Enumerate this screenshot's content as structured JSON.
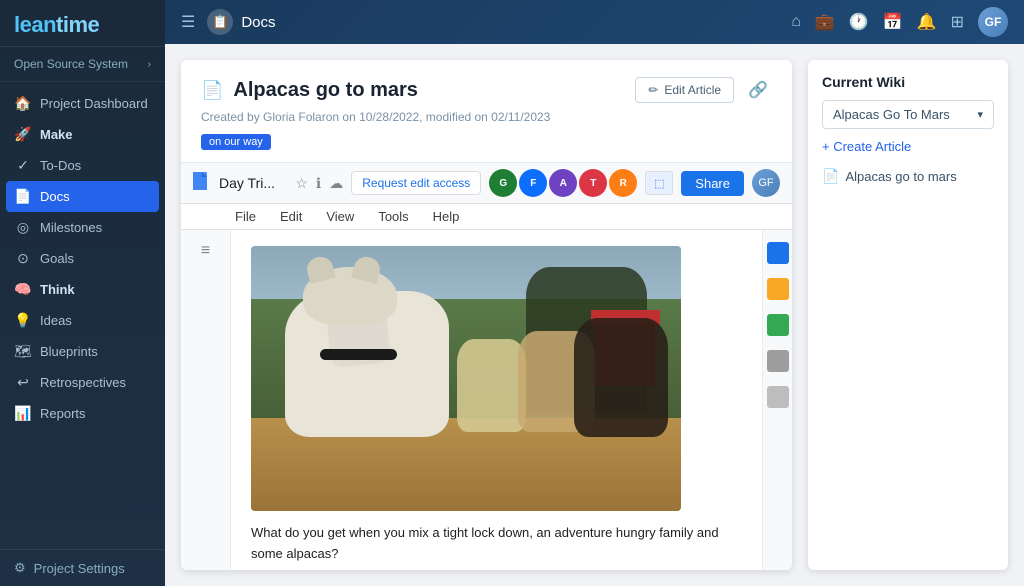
{
  "app": {
    "logo": "leantime",
    "workspace": "Open Source System"
  },
  "topbar": {
    "page_title": "Docs",
    "nav_icons": [
      "home",
      "briefcase",
      "clock",
      "calendar",
      "bell",
      "grid"
    ],
    "avatar_initials": "GF"
  },
  "sidebar": {
    "items": [
      {
        "id": "project-dashboard",
        "label": "Project Dashboard",
        "icon": "🏠",
        "active": false
      },
      {
        "id": "make",
        "label": "Make",
        "icon": "🚀",
        "active": false,
        "section": true
      },
      {
        "id": "to-dos",
        "label": "To-Dos",
        "icon": "✓",
        "active": false
      },
      {
        "id": "docs",
        "label": "Docs",
        "icon": "📄",
        "active": true
      },
      {
        "id": "milestones",
        "label": "Milestones",
        "icon": "◎",
        "active": false
      },
      {
        "id": "goals",
        "label": "Goals",
        "icon": "⊙",
        "active": false
      },
      {
        "id": "think",
        "label": "Think",
        "icon": "🧠",
        "active": false,
        "section": true
      },
      {
        "id": "ideas",
        "label": "Ideas",
        "icon": "💡",
        "active": false
      },
      {
        "id": "blueprints",
        "label": "Blueprints",
        "icon": "🗺",
        "active": false
      },
      {
        "id": "retrospectives",
        "label": "Retrospectives",
        "icon": "↩",
        "active": false
      },
      {
        "id": "reports",
        "label": "Reports",
        "icon": "📊",
        "active": false
      }
    ],
    "settings_label": "Project Settings"
  },
  "doc": {
    "title": "Alpacas go to mars",
    "icon": "📄",
    "meta": "Created by Gloria Folaron on 10/28/2022, modified on 02/11/2023",
    "tag": "on our way",
    "edit_btn": "Edit Article",
    "gdocs": {
      "doc_name": "Day Tri...",
      "menu": [
        "File",
        "Edit",
        "View",
        "Tools",
        "Help"
      ],
      "req_edit": "Request edit access",
      "share": "Share",
      "avatars": [
        "G",
        "F",
        "A",
        "T",
        "R"
      ],
      "avatar_colors": [
        "#1e7e34",
        "#0d6efd",
        "#6f42c1",
        "#dc3545",
        "#fd7e14"
      ],
      "body_text": "What do you get when you mix a tight lock down, an adventure hungry family and some alpacas?"
    }
  },
  "wiki": {
    "title": "Current Wiki",
    "selected": "Alpacas Go To Mars",
    "create_link": "+ Create Article",
    "articles": [
      {
        "label": "Alpacas go to mars"
      }
    ]
  }
}
